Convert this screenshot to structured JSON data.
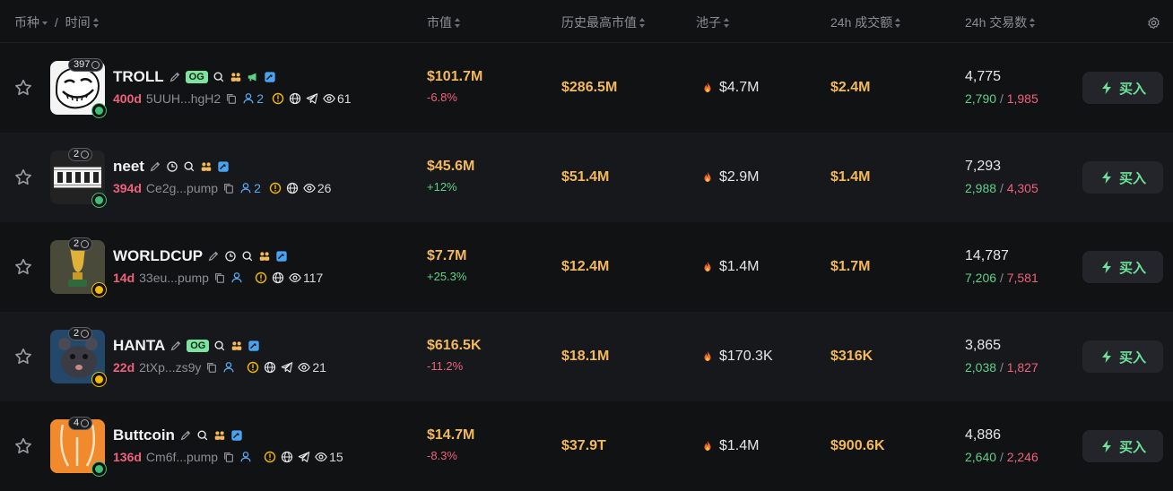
{
  "header": {
    "coin": "币种",
    "slash": "/",
    "time": "时间",
    "mcap": "市值",
    "ath": "历史最高市值",
    "pool": "池子",
    "volume": "24h 成交额",
    "txs": "24h 交易数"
  },
  "colors": {
    "accent_gold": "#f3b95a",
    "up": "#5fd08a",
    "down": "#f0617d",
    "holders_blue": "#5aa9f0"
  },
  "rows": [
    {
      "holders_count": "397",
      "name": "TROLL",
      "og": "OG",
      "age": "400d",
      "address": "5UUH...hgH2",
      "holders": "2",
      "views": "61",
      "mcap": "$101.7M",
      "change": "-6.8%",
      "ath": "$286.5M",
      "pool": "$4.7M",
      "volume": "$2.4M",
      "txs": "4,775",
      "buys": "2,790",
      "sep": "/",
      "sells": "1,985",
      "buy_label": "买入"
    },
    {
      "holders_count": "2",
      "name": "neet",
      "age": "394d",
      "address": "Ce2g...pump",
      "holders": "2",
      "views": "26",
      "mcap": "$45.6M",
      "change": "+12%",
      "ath": "$51.4M",
      "pool": "$2.9M",
      "volume": "$1.4M",
      "txs": "7,293",
      "buys": "2,988",
      "sep": "/",
      "sells": "4,305",
      "buy_label": "买入"
    },
    {
      "holders_count": "2",
      "name": "WORLDCUP",
      "age": "14d",
      "address": "33eu...pump",
      "views": "117",
      "mcap": "$7.7M",
      "change": "+25.3%",
      "ath": "$12.4M",
      "pool": "$1.4M",
      "volume": "$1.7M",
      "txs": "14,787",
      "buys": "7,206",
      "sep": "/",
      "sells": "7,581",
      "buy_label": "买入"
    },
    {
      "holders_count": "2",
      "name": "HANTA",
      "og": "OG",
      "age": "22d",
      "address": "2tXp...zs9y",
      "views": "21",
      "mcap": "$616.5K",
      "change": "-11.2%",
      "ath": "$18.1M",
      "pool": "$170.3K",
      "volume": "$316K",
      "txs": "3,865",
      "buys": "2,038",
      "sep": "/",
      "sells": "1,827",
      "buy_label": "买入"
    },
    {
      "holders_count": "4",
      "name": "Buttcoin",
      "age": "136d",
      "address": "Cm6f...pump",
      "views": "15",
      "mcap": "$14.7M",
      "change": "-8.3%",
      "ath": "$37.9T",
      "pool": "$1.4M",
      "volume": "$900.6K",
      "txs": "4,886",
      "buys": "2,640",
      "sep": "/",
      "sells": "2,246",
      "buy_label": "买入"
    }
  ]
}
